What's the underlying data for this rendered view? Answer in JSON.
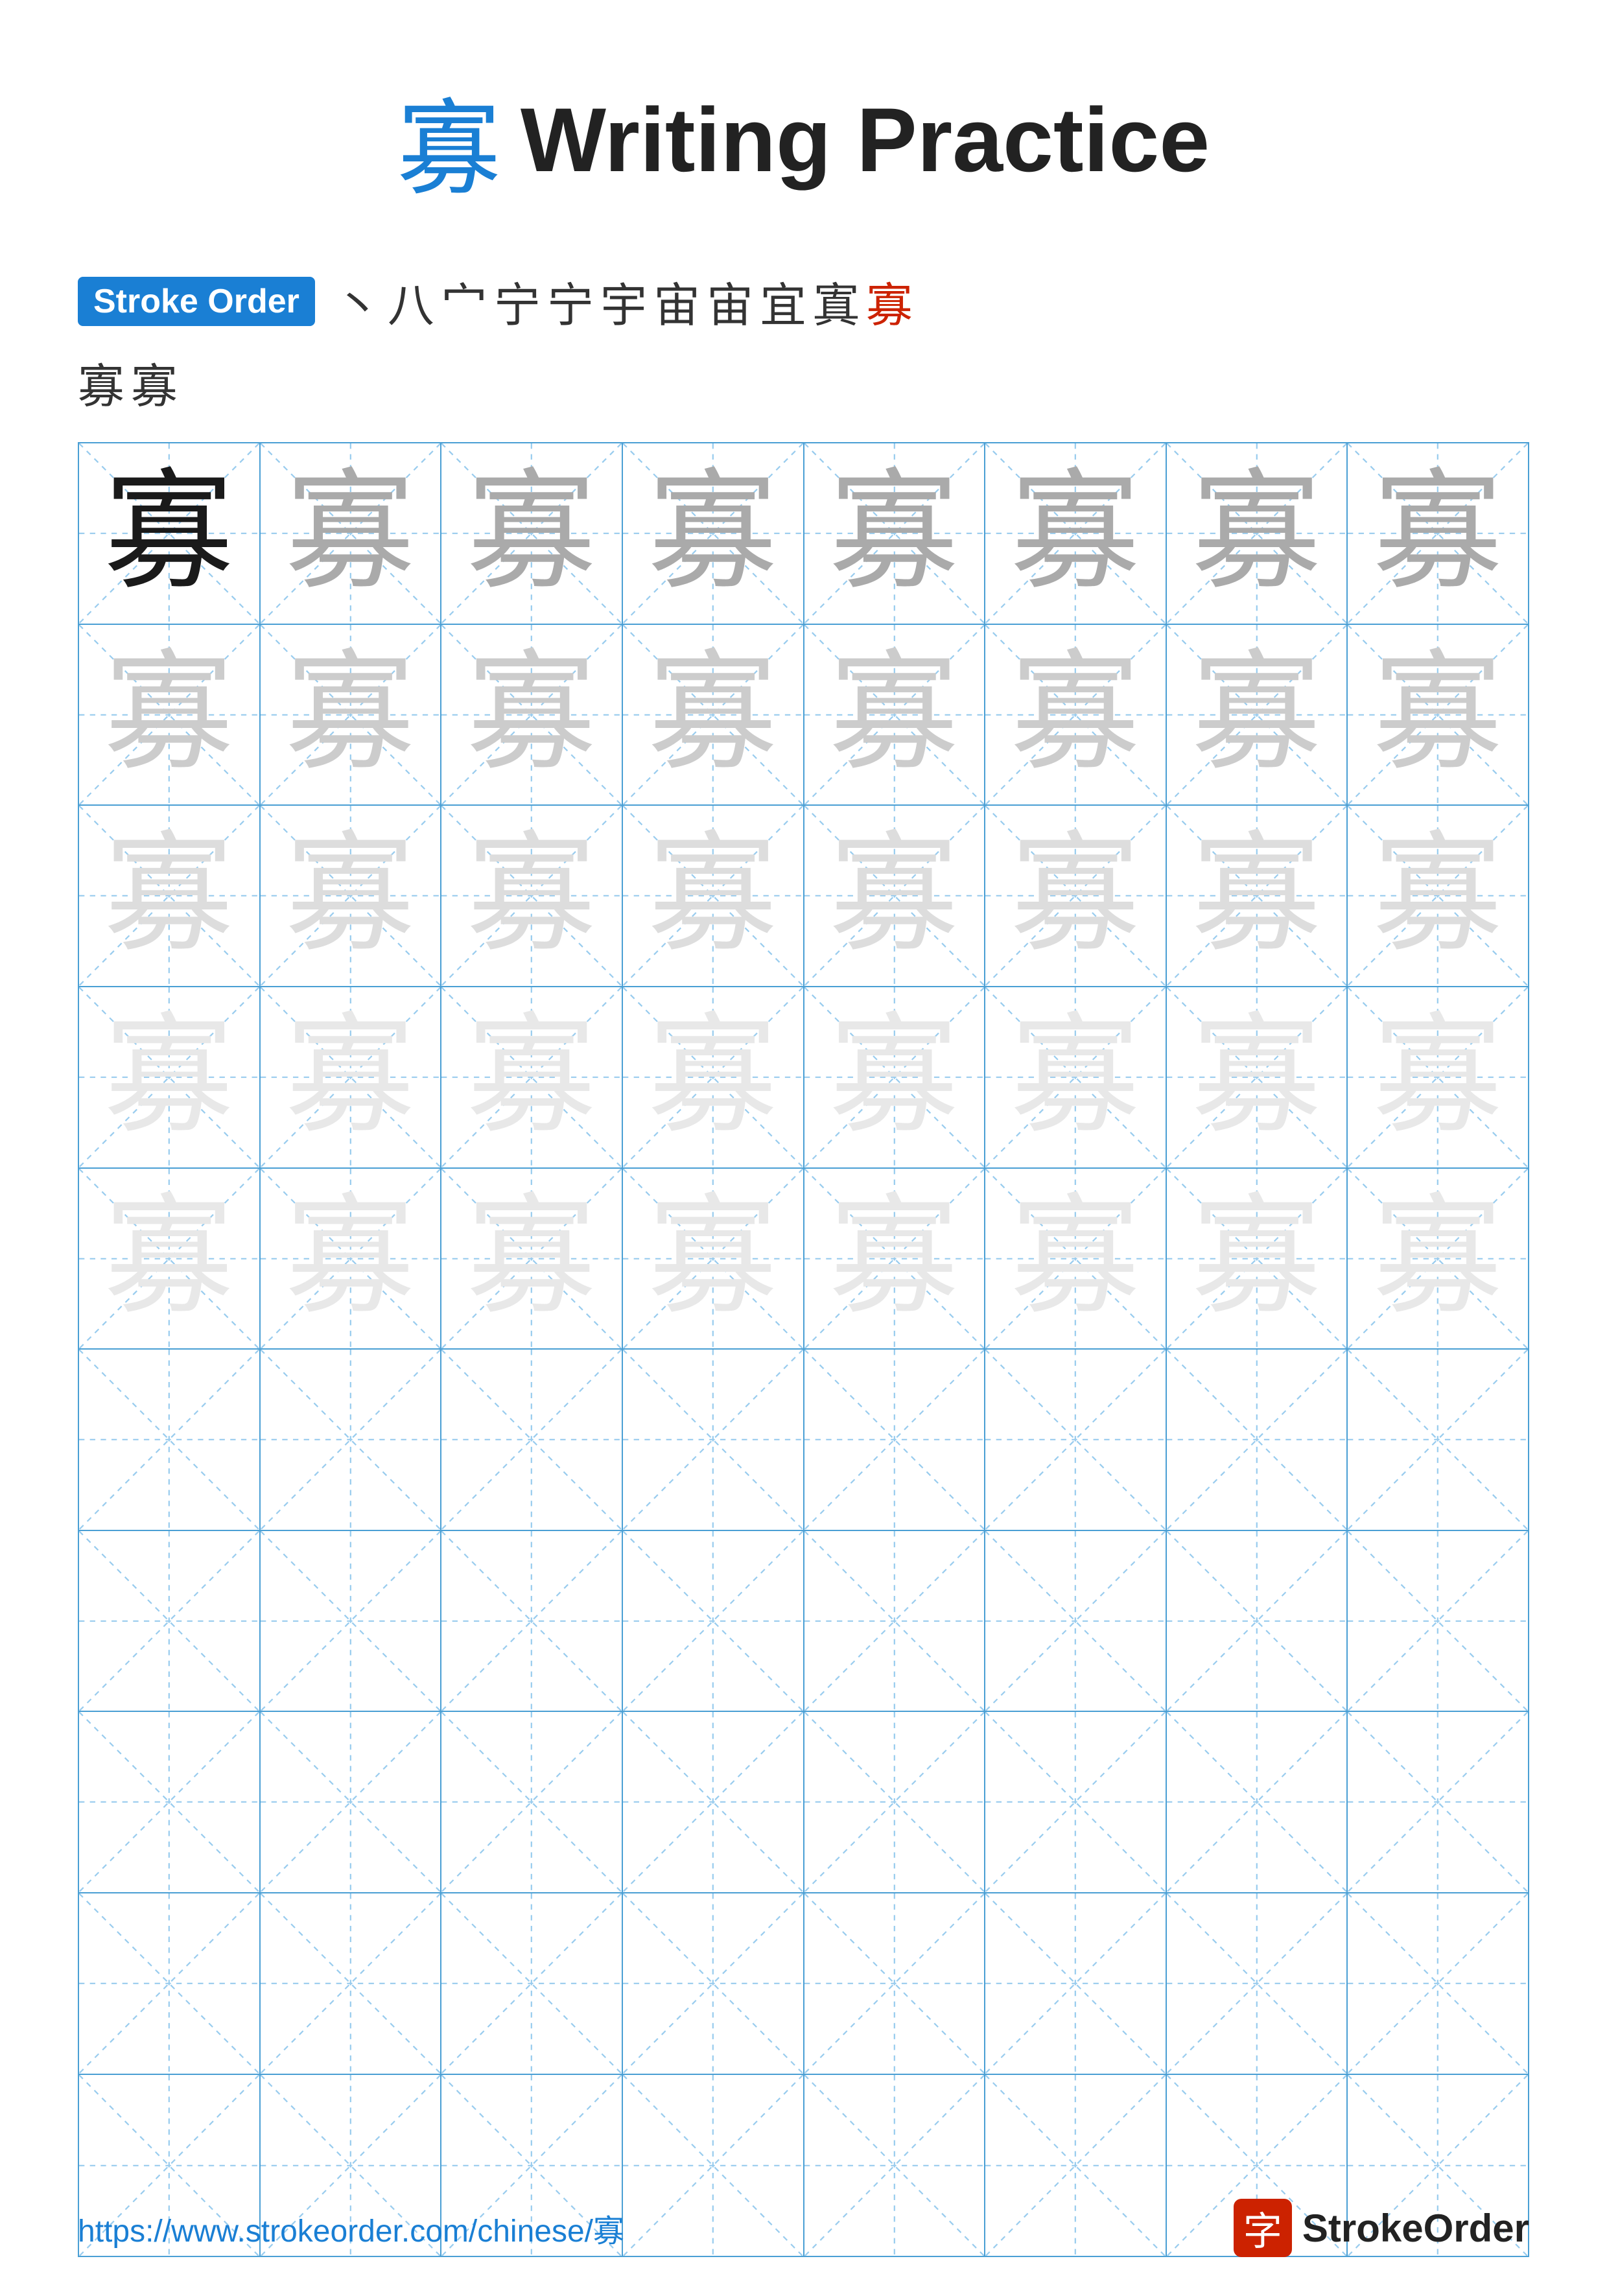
{
  "title": {
    "char": "寡",
    "text": "Writing Practice"
  },
  "stroke_order": {
    "badge_label": "Stroke Order",
    "strokes": [
      "丶",
      "八",
      "宀",
      "宁",
      "宁",
      "宇",
      "宙",
      "宙",
      "宜",
      "寘",
      "寡"
    ],
    "row2": [
      "寡",
      "寡"
    ]
  },
  "grid": {
    "char": "寡",
    "rows": 10,
    "cols": 8,
    "filled_rows": 5,
    "char_opacities": [
      [
        "dark",
        "medium",
        "medium",
        "medium",
        "medium",
        "medium",
        "medium",
        "medium"
      ],
      [
        "light",
        "light",
        "light",
        "light",
        "light",
        "light",
        "light",
        "light"
      ],
      [
        "very-light",
        "very-light",
        "very-light",
        "very-light",
        "very-light",
        "very-light",
        "very-light",
        "very-light"
      ],
      [
        "faintest",
        "faintest",
        "faintest",
        "faintest",
        "faintest",
        "faintest",
        "faintest",
        "faintest"
      ],
      [
        "faintest",
        "faintest",
        "faintest",
        "faintest",
        "faintest",
        "faintest",
        "faintest",
        "faintest"
      ]
    ]
  },
  "footer": {
    "url": "https://www.strokeorder.com/chinese/寡",
    "logo_char": "字",
    "logo_text": "StrokeOrder"
  }
}
